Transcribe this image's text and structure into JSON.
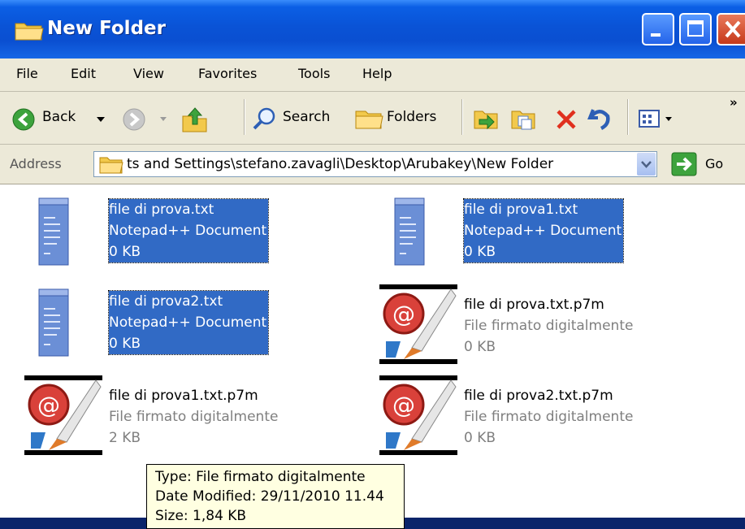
{
  "window": {
    "title": "New Folder"
  },
  "menu": {
    "items": [
      "File",
      "Edit",
      "View",
      "Favorites",
      "Tools",
      "Help"
    ]
  },
  "toolbar": {
    "back_label": "Back",
    "search_label": "Search",
    "folders_label": "Folders",
    "more_chevron": "»"
  },
  "address": {
    "label": "Address",
    "value": "ts and Settings\\stefano.zavagli\\Desktop\\Arubakey\\New Folder",
    "go_label": "Go"
  },
  "files": [
    {
      "name": "file di prova.txt",
      "type": "Notepad++ Document",
      "size": "0 KB",
      "icon": "notepad-document-icon",
      "selected": true
    },
    {
      "name": "file di prova1.txt",
      "type": "Notepad++ Document",
      "size": "0 KB",
      "icon": "notepad-document-icon",
      "selected": true
    },
    {
      "name": "file di prova2.txt",
      "type": "Notepad++ Document",
      "size": "0 KB",
      "icon": "notepad-document-icon",
      "selected": true
    },
    {
      "name": "file di prova.txt.p7m",
      "type": "File firmato digitalmente",
      "size": "0 KB",
      "icon": "signed-file-icon",
      "selected": false
    },
    {
      "name": "file di prova1.txt.p7m",
      "type": "File firmato digitalmente",
      "size": "2 KB",
      "icon": "signed-file-icon",
      "selected": false
    },
    {
      "name": "file di prova2.txt.p7m",
      "type": "File firmato digitalmente",
      "size": "0 KB",
      "icon": "signed-file-icon",
      "selected": false
    }
  ],
  "tooltip": {
    "type_line": "Type: File firmato digitalmente",
    "date_line": "Date Modified: 29/11/2010 11.44",
    "size_line": "Size: 1,84 KB"
  },
  "colors": {
    "titlebar": "#0a53d6",
    "chrome": "#ece9d8",
    "selection": "#316ac5",
    "tooltip_bg": "#ffffe1",
    "secondary_text": "#7f7f7f"
  }
}
